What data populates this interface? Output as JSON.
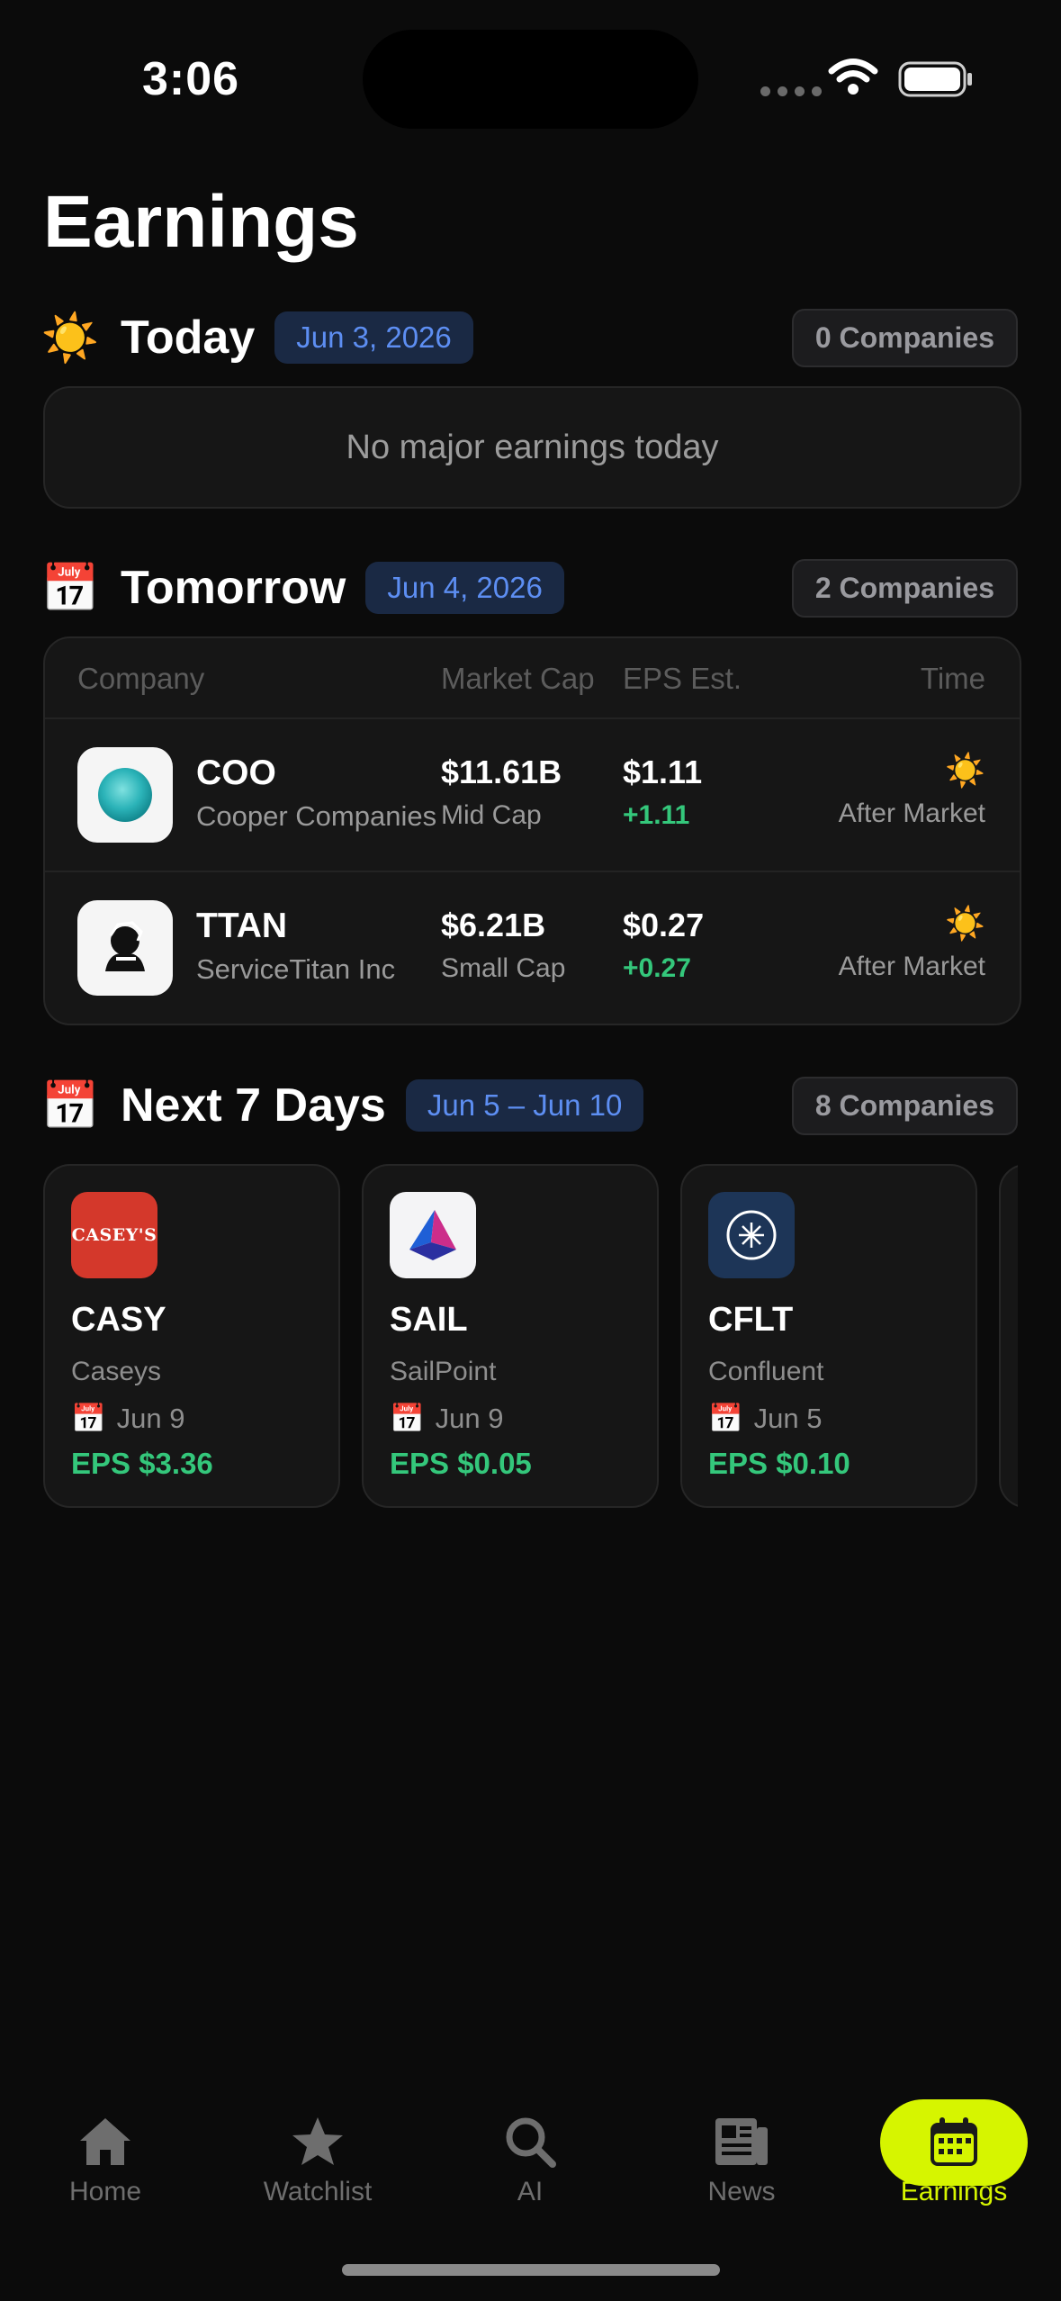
{
  "status_bar": {
    "time": "3:06"
  },
  "page": {
    "title": "Earnings"
  },
  "today": {
    "emoji": "☀️",
    "title": "Today",
    "date": "Jun 3, 2026",
    "count": "0 Companies",
    "empty_message": "No major earnings today"
  },
  "tomorrow": {
    "emoji": "📅",
    "title": "Tomorrow",
    "date": "Jun 4, 2026",
    "count": "2 Companies",
    "columns": [
      "Company",
      "Market Cap",
      "EPS Est.",
      "Time"
    ],
    "rows": [
      {
        "symbol": "COO",
        "name": "Cooper Companies",
        "market_cap": "$11.61B",
        "cap_tier": "Mid Cap",
        "eps": "$1.11",
        "eps_diff": "+1.11",
        "time_icon": "☀️",
        "time": "After Market"
      },
      {
        "symbol": "TTAN",
        "name": "ServiceTitan Inc",
        "market_cap": "$6.21B",
        "cap_tier": "Small Cap",
        "eps": "$0.27",
        "eps_diff": "+0.27",
        "time_icon": "☀️",
        "time": "After Market"
      }
    ]
  },
  "next7": {
    "emoji": "📅",
    "title": "Next 7 Days",
    "date": "Jun 5 – Jun 10",
    "count": "8 Companies",
    "cards": [
      {
        "symbol": "CASY",
        "name": "Caseys",
        "logo_text": "CASEY'S",
        "date_icon": "📅",
        "date": "Jun 9",
        "eps": "EPS $3.36"
      },
      {
        "symbol": "SAIL",
        "name": "SailPoint",
        "date_icon": "📅",
        "date": "Jun 9",
        "eps": "EPS $0.05"
      },
      {
        "symbol": "CFLT",
        "name": "Confluent",
        "date_icon": "📅",
        "date": "Jun 5",
        "eps": "EPS $0.10"
      }
    ]
  },
  "tabs": [
    {
      "label": "Home",
      "icon": "house-icon"
    },
    {
      "label": "Watchlist",
      "icon": "star-icon"
    },
    {
      "label": "AI",
      "icon": "magnifier-icon"
    },
    {
      "label": "News",
      "icon": "newspaper-icon"
    },
    {
      "label": "Earnings",
      "icon": "calendar-icon",
      "active": true
    }
  ],
  "colors": {
    "accent": "#d6f500",
    "positive": "#34c77b",
    "date_pill_text": "#5d8ef2",
    "background": "#0b0b0b"
  }
}
